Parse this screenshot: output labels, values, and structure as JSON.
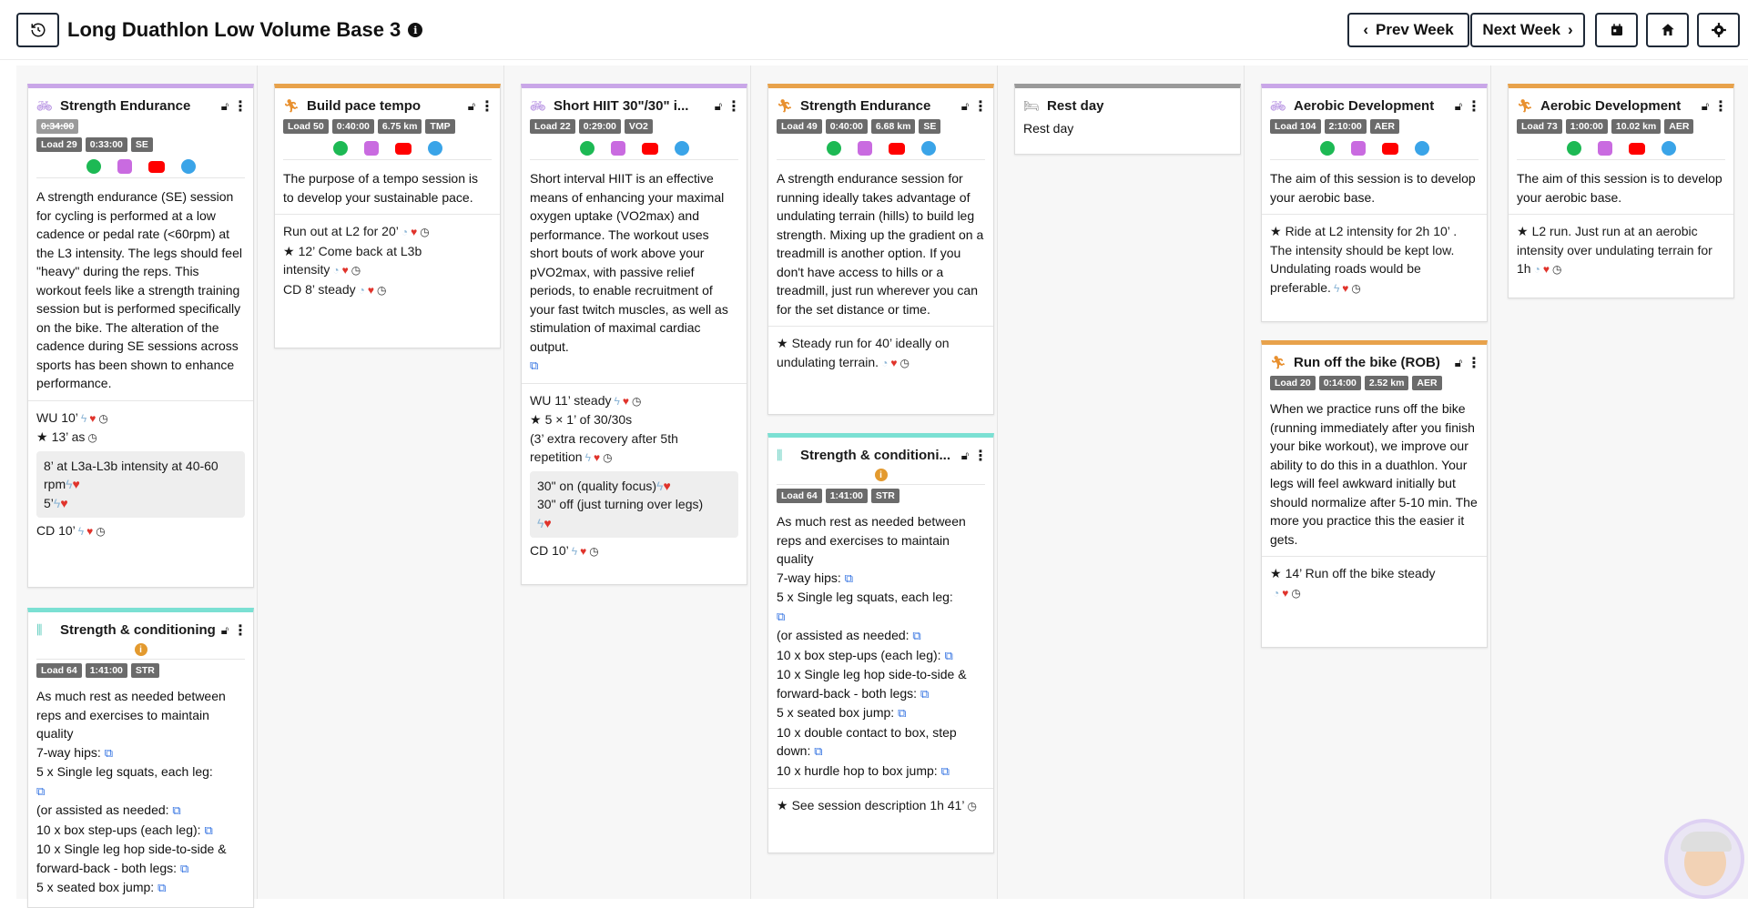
{
  "header": {
    "title": "Long Duathlon Low Volume Base 3",
    "prev_label": "Prev Week",
    "next_label": "Next Week"
  },
  "cards": {
    "c1": {
      "name": "Strength Endurance",
      "badges": [
        "0:34:00",
        "Load 29",
        "0:33:00",
        "SE"
      ],
      "desc": "A strength endurance (SE) session for cycling is performed at a low cadence or pedal rate (<60rpm) at the L3 intensity. The legs should feel \"heavy\" during the reps. This workout feels like a strength training session but is performed specifically on the bike. The alteration of the cadence during SE sessions across sports has been shown to enhance performance.",
      "s1": "WU 10’",
      "s2": "13’ as",
      "s3": "8’ at L3a-L3b intensity at 40-60 rpm",
      "s4": "5’",
      "s5": "CD 10’"
    },
    "c2": {
      "name": "Strength & conditioning",
      "badges": [
        "Load 64",
        "1:41:00",
        "STR"
      ],
      "d1": "As much rest as needed between reps and exercises to maintain quality",
      "d2": "7-way hips:",
      "d3": "5 x Single leg squats, each leg:",
      "d4": "(or assisted as needed:",
      "d5": "10 x box step-ups (each leg):",
      "d6": "10 x Single leg hop side-to-side & forward-back - both legs:",
      "d7": "5 x seated box jump:"
    },
    "c3": {
      "name": "Build pace tempo",
      "badges": [
        "Load 50",
        "0:40:00",
        "6.75 km",
        "TMP"
      ],
      "desc": "The purpose of a tempo session is to develop your sustainable pace.",
      "s1": "Run out at L2 for 20’",
      "s2": "12’ Come back at L3b intensity",
      "s3": "CD 8’ steady"
    },
    "c4": {
      "name": "Short HIIT 30\"/30\" i...",
      "badges": [
        "Load 22",
        "0:29:00",
        "VO2"
      ],
      "desc": "Short interval HIIT is an effective means of enhancing your maximal oxygen uptake (VO2max) and performance. The workout uses short bouts of work above your pVO2max, with passive relief periods, to enable recruitment of your fast twitch muscles, as well as stimulation of maximal cardiac output.",
      "s1": "WU 11’ steady",
      "s2": "5 × 1’ of 30/30s",
      "s3": "(3’ extra recovery after 5th repetition",
      "s4": "30\" on (quality focus)",
      "s5": "30\" off (just turning over legs)",
      "s6": "CD 10’"
    },
    "c5": {
      "name": "Strength Endurance",
      "badges": [
        "Load 49",
        "0:40:00",
        "6.68 km",
        "SE"
      ],
      "desc": "A strength endurance session for running ideally takes advantage of undulating terrain (hills) to build leg strength. Mixing up the gradient on a treadmill is another option. If you don't have access to hills or a treadmill, just run wherever you can for the set distance or time.",
      "s1": "Steady run for 40’ ideally on undulating terrain."
    },
    "c6": {
      "name": "Strength & conditioni...",
      "badges": [
        "Load 64",
        "1:41:00",
        "STR"
      ],
      "d1": "As much rest as needed between reps and exercises to maintain quality",
      "d2": "7-way hips:",
      "d3": "5 x Single leg squats, each leg:",
      "d4": "(or assisted as needed:",
      "d5": "10 x box step-ups (each leg):",
      "d6": "10 x Single leg hop side-to-side & forward-back - both legs:",
      "d7": "5 x seated box jump:",
      "d8": "10 x double contact to box, step down:",
      "d9": "10 x hurdle hop to box jump:",
      "s1": "See session description 1h 41’"
    },
    "c7": {
      "name": "Rest day",
      "desc": "Rest day"
    },
    "c8": {
      "name": "Aerobic Development",
      "badges": [
        "Load 104",
        "2:10:00",
        "AER"
      ],
      "desc": "The aim of this session is to develop your aerobic base.",
      "s1": "Ride at L2 intensity for 2h 10’ . The intensity should be kept low. Undulating roads would be preferable."
    },
    "c9": {
      "name": "Run off the bike (ROB)",
      "badges": [
        "Load 20",
        "0:14:00",
        "2.52 km",
        "AER"
      ],
      "desc": "When we practice runs off the bike (running immediately after you finish your bike workout), we improve our ability to do this in a duathlon. Your legs will feel awkward initially but should normalize after 5-10 min. The more you practice this the easier it gets.",
      "s1": "14’ Run off the bike steady"
    },
    "c10": {
      "name": "Aerobic Development",
      "badges": [
        "Load 73",
        "1:00:00",
        "10.02 km",
        "AER"
      ],
      "desc": "The aim of this session is to develop your aerobic base.",
      "s1": "L2 run. Just run at an aerobic intensity over undulating terrain for 1h"
    }
  }
}
